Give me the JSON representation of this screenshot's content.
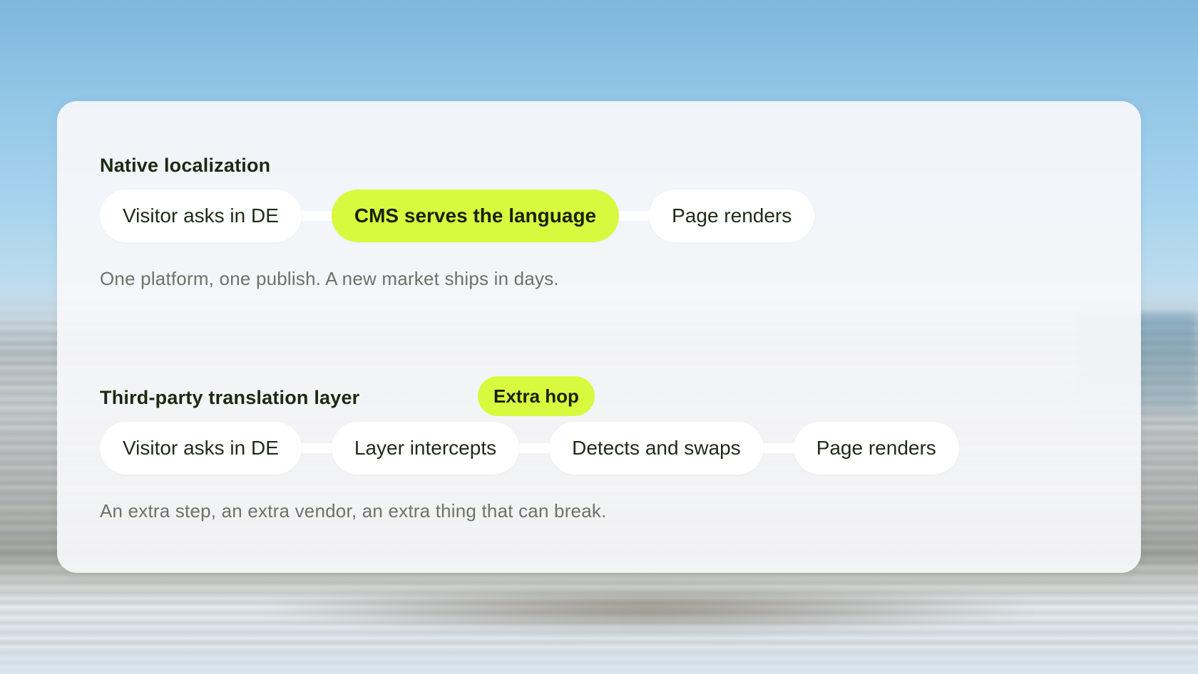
{
  "native": {
    "title": "Native localization",
    "steps": [
      "Visitor asks in DE",
      "CMS serves the language",
      "Page renders"
    ],
    "highlight_index": 1,
    "caption": "One platform, one publish. A new market ships in days."
  },
  "third_party": {
    "title": "Third-party translation layer",
    "badge": "Extra hop",
    "steps": [
      "Visitor asks in DE",
      "Layer intercepts",
      "Detects and swaps",
      "Page renders"
    ],
    "caption": "An extra step, an extra vendor, an extra thing that can break."
  },
  "colors": {
    "accent": "#d9f93f",
    "title_text": "#1b2a12",
    "caption_text": "#6e7268",
    "card_background": "#f8f8fa"
  }
}
